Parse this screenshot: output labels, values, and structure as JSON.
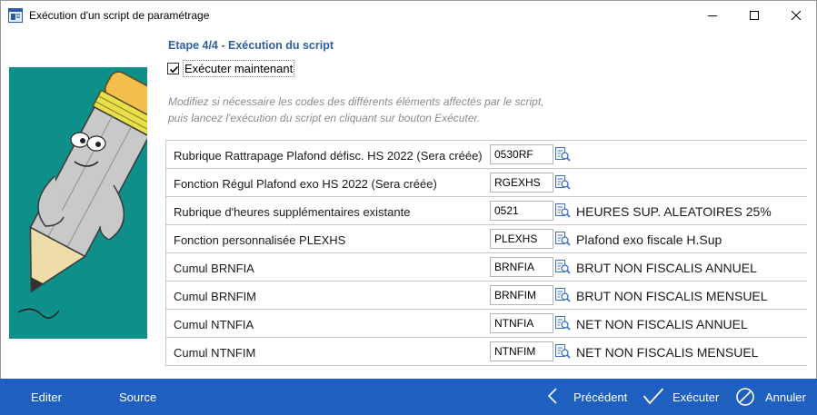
{
  "window": {
    "title": "Exécution d'un script de paramétrage"
  },
  "step": {
    "title": "Etape 4/4 - Exécution du script"
  },
  "options": {
    "execute_now_label": "Exécuter maintenant",
    "execute_now_checked": true
  },
  "hint": {
    "line1": "Modifiez si nécessaire les codes des différents éléments affectés par le script,",
    "line2": "puis lancez l'exécution du script en cliquant sur bouton Exécuter."
  },
  "rows": [
    {
      "label": "Rubrique Rattrapage Plafond défisc. HS 2022 (Sera créée)",
      "code": "0530RF",
      "description": ""
    },
    {
      "label": "Fonction Régul Plafond exo HS 2022 (Sera créée)",
      "code": "RGEXHS",
      "description": ""
    },
    {
      "label": "Rubrique d'heures supplémentaires existante",
      "code": "0521",
      "description": "HEURES SUP. ALEATOIRES 25%"
    },
    {
      "label": "Fonction personnalisée PLEXHS",
      "code": "PLEXHS",
      "description": "Plafond exo fiscale H.Sup"
    },
    {
      "label": "Cumul BRNFIA",
      "code": "BRNFIA",
      "description": "BRUT NON FISCALIS ANNUEL"
    },
    {
      "label": "Cumul BRNFIM",
      "code": "BRNFIM",
      "description": "BRUT NON FISCALIS MENSUEL"
    },
    {
      "label": "Cumul NTNFIA",
      "code": "NTNFIA",
      "description": "NET NON FISCALIS ANNUEL"
    },
    {
      "label": "Cumul NTNFIM",
      "code": "NTNFIM",
      "description": "NET NON FISCALIS MENSUEL"
    }
  ],
  "bottom_bar": {
    "editer_label": "Editer",
    "source_label": "Source",
    "precedent_label": "Précédent",
    "executer_label": "Exécuter",
    "annuler_label": "Annuler"
  },
  "icons": {
    "app": "app-window-icon",
    "lookup": "magnifier-lookup-icon",
    "precedent": "chevron-left-icon",
    "executer": "checkmark-icon",
    "annuler": "cancel-circle-icon"
  },
  "colors": {
    "accent_blue": "#1f5fbf",
    "step_title": "#2f5f9e",
    "illustration_bg": "#0e8f8a",
    "hint_text": "#8a8a8a"
  }
}
